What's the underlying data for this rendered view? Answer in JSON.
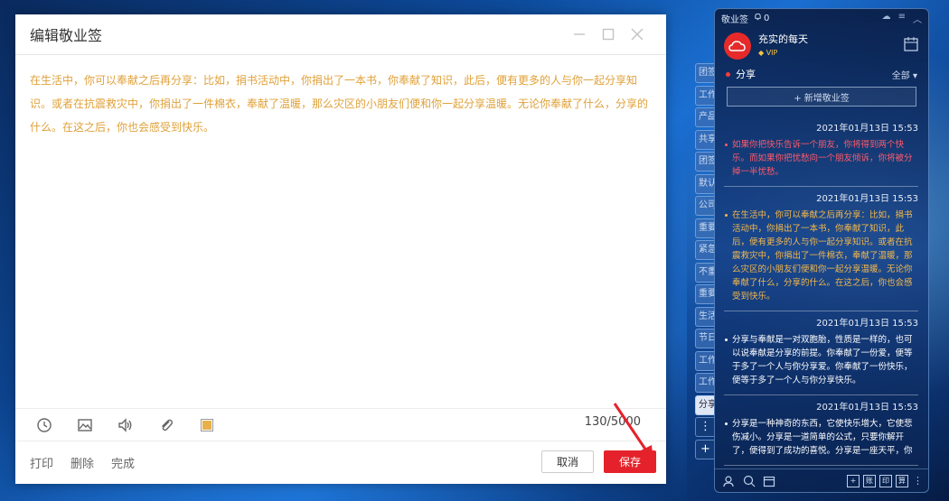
{
  "dialog": {
    "title": "编辑敬业签",
    "content": "在生活中，你可以奉献之后再分享：比如，捐书活动中，你捐出了一本书，你奉献了知识，此后，便有更多的人与你一起分享知识。或者在抗震救灾中，你捐出了一件棉衣，奉献了温暖，那么灾区的小朋友们便和你一起分享温暖。无论你奉献了什么，分享的什么。在这之后，你也会感受到快乐。",
    "counter": "130/5000",
    "footer_links": [
      "打印",
      "删除",
      "完成"
    ],
    "cancel_label": "取消",
    "save_label": "保存",
    "text_color": "#e0a13a",
    "swatch_color": "#e6b04a"
  },
  "widget": {
    "app_name": "敬业签",
    "bell_count": "0",
    "username": "充实的每天",
    "vip_label": "VIP",
    "section_title": "分享",
    "filter_label": "全部",
    "new_note_label": "+ 新增敬业签",
    "tabs": [
      "团签",
      "工作",
      "产品",
      "共享",
      "团签",
      "默认",
      "公司",
      "重要",
      "紧急",
      "不重",
      "重要",
      "生活",
      "节日",
      "工作",
      "工作",
      "分享"
    ],
    "notes": [
      {
        "date": "2021年01月13日 15:53",
        "text": "如果你把快乐告诉一个朋友，你将得到两个快乐。而如果你把忧愁向一个朋友倾诉，你将被分掉一半忧愁。",
        "color": "#ff5a6a"
      },
      {
        "date": "2021年01月13日 15:53",
        "text": "在生活中，你可以奉献之后再分享：比如，捐书活动中，你捐出了一本书，你奉献了知识，此后，便有更多的人与你一起分享知识。或者在抗震救灾中，你捐出了一件棉衣，奉献了温暖，那么灾区的小朋友们便和你一起分享温暖。无论你奉献了什么，分享的什么。在这之后，你也会感受到快乐。",
        "color": "#f5b84a"
      },
      {
        "date": "2021年01月13日 15:53",
        "text": "分享与奉献是一对双胞胎，性质是一样的，也可以说奉献是分享的前提。你奉献了一份爱，便等于多了一个人与你分享爱。你奉献了一份快乐，便等于多了一个人与你分享快乐。",
        "color": "#ffffff"
      },
      {
        "date": "2021年01月13日 15:53",
        "text": "分享是一种神奇的东西，它使快乐增大，它使悲伤减小。分享是一道简单的公式，只要你解开了，便得到了成功的喜悦。分享是一座天平，你",
        "color": "#ffffff"
      }
    ],
    "bottom_boxes": [
      "+",
      "账",
      "印",
      "算"
    ]
  }
}
